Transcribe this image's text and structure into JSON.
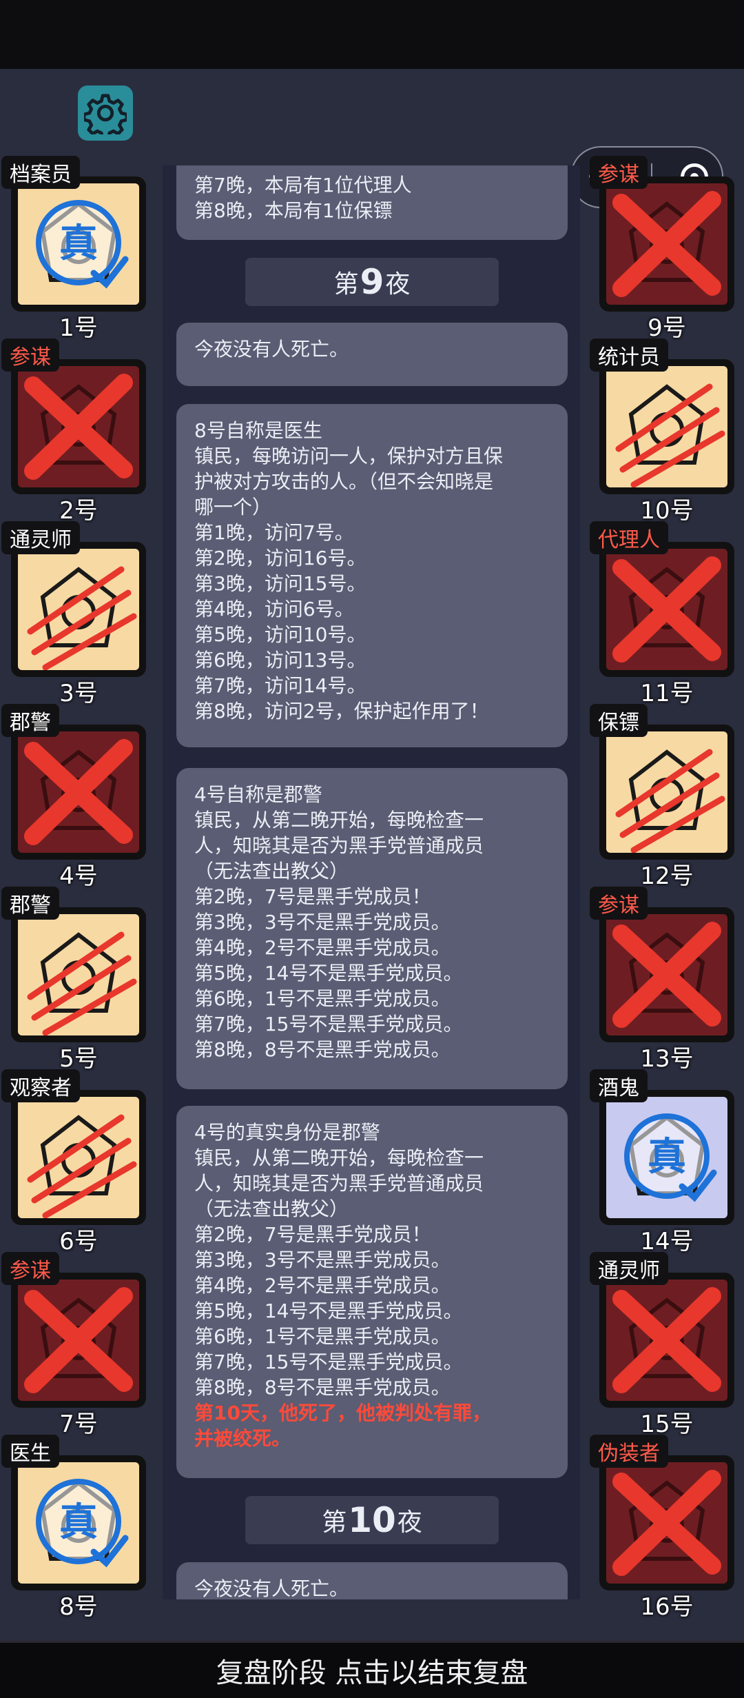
{
  "settings_icon": "gear-icon",
  "menu_capsule": {
    "more_icon": "more-dots-icon",
    "close_icon": "target-close-icon"
  },
  "players_left": [
    {
      "role": "档案员",
      "num": "1号",
      "status": "true",
      "role_color": "white",
      "icon": "archivist-icon"
    },
    {
      "role": "参谋",
      "num": "2号",
      "status": "dead-x",
      "role_color": "red",
      "icon": "strategist-icon"
    },
    {
      "role": "通灵师",
      "num": "3号",
      "status": "slash",
      "role_color": "white",
      "icon": "medium-icon"
    },
    {
      "role": "郡警",
      "num": "4号",
      "status": "dead-x",
      "role_color": "white",
      "icon": "sheriff-icon"
    },
    {
      "role": "郡警",
      "num": "5号",
      "status": "slash",
      "role_color": "white",
      "icon": "sheriff-icon"
    },
    {
      "role": "观察者",
      "num": "6号",
      "status": "slash",
      "role_color": "white",
      "icon": "observer-icon"
    },
    {
      "role": "参谋",
      "num": "7号",
      "status": "dead-x",
      "role_color": "red",
      "icon": "strategist-icon"
    },
    {
      "role": "医生",
      "num": "8号",
      "status": "true",
      "role_color": "white",
      "icon": "doctor-icon"
    }
  ],
  "players_right": [
    {
      "role": "参谋",
      "num": "9号",
      "status": "dead-x",
      "role_color": "red",
      "icon": "strategist-icon"
    },
    {
      "role": "统计员",
      "num": "10号",
      "status": "slash",
      "role_color": "white",
      "icon": "statistician-icon"
    },
    {
      "role": "代理人",
      "num": "11号",
      "status": "dead-x",
      "role_color": "red",
      "icon": "agent-icon"
    },
    {
      "role": "保镖",
      "num": "12号",
      "status": "slash",
      "role_color": "white",
      "icon": "bodyguard-icon"
    },
    {
      "role": "参谋",
      "num": "13号",
      "status": "dead-x",
      "role_color": "red",
      "icon": "strategist-icon"
    },
    {
      "role": "酒鬼",
      "num": "14号",
      "status": "true-lavender",
      "role_color": "white",
      "icon": "drunk-icon"
    },
    {
      "role": "通灵师",
      "num": "15号",
      "status": "dead-x",
      "role_color": "white",
      "icon": "medium-icon"
    },
    {
      "role": "伪装者",
      "num": "16号",
      "status": "dead-x",
      "role_color": "red",
      "icon": "disguiser-icon"
    }
  ],
  "true_badge_text": "真",
  "log": {
    "msg0": [
      "第7晚，本局有1位代理人",
      "第8晚，本局有1位保镖"
    ],
    "night9": {
      "prefix": "第",
      "num": "9",
      "suffix": "夜"
    },
    "msg1": [
      "今夜没有人死亡。"
    ],
    "msg2": [
      "8号自称是医生",
      "镇民，每晚访问一人，保护对方且保",
      "护被对方攻击的人。（但不会知晓是",
      "哪一个）",
      "第1晚，访问7号。",
      "第2晚，访问16号。",
      "第3晚，访问15号。",
      "第4晚，访问6号。",
      "第5晚，访问10号。",
      "第6晚，访问13号。",
      "第7晚，访问14号。",
      "第8晚，访问2号，保护起作用了！"
    ],
    "msg3": [
      "4号自称是郡警",
      "镇民，从第二晚开始，每晚检查一",
      "人，知晓其是否为黑手党普通成员",
      "（无法查出教父）",
      "第2晚，7号是黑手党成员！",
      "第3晚，3号不是黑手党成员。",
      "第4晚，2号不是黑手党成员。",
      "第5晚，14号不是黑手党成员。",
      "第6晚，1号不是黑手党成员。",
      "第7晚，15号不是黑手党成员。",
      "第8晚，8号不是黑手党成员。"
    ],
    "msg4": [
      "4号的真实身份是郡警",
      "镇民，从第二晚开始，每晚检查一",
      "人，知晓其是否为黑手党普通成员",
      "（无法查出教父）",
      "第2晚，7号是黑手党成员！",
      "第3晚，3号不是黑手党成员。",
      "第4晚，2号不是黑手党成员。",
      "第5晚，14号不是黑手党成员。",
      "第6晚，1号不是黑手党成员。",
      "第7晚，15号不是黑手党成员。",
      "第8晚，8号不是黑手党成员。"
    ],
    "msg4_red": [
      "第10天，他死了，他被判处有罪，",
      "并被绞死。"
    ],
    "night10": {
      "prefix": "第",
      "num": "10",
      "suffix": "夜"
    },
    "msg5": [
      "今夜没有人死亡。"
    ]
  },
  "bottom_button": "复盘阶段 点击以结束复盘",
  "colors": {
    "card_bg": "#f7d9a3",
    "dead_bg": "#6e1e22",
    "true_bg_alt": "#c9caf0",
    "x_red": "#e8372c",
    "true_blue": "#1e72d8",
    "role_red": "#ff5a4a",
    "teal": "#2a8d9a"
  }
}
